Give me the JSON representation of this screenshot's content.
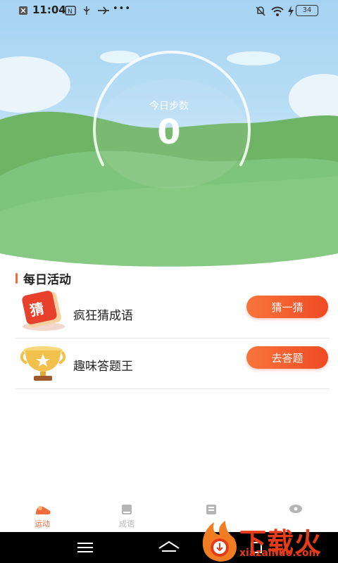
{
  "status_bar": {
    "time": "11:04",
    "notification_icons": [
      "close-box-icon",
      "mute-icon",
      "usb-icon",
      "airplane-icon"
    ],
    "more": "•••",
    "battery": "34"
  },
  "hero": {
    "label": "今日步数",
    "steps": "0"
  },
  "daily": {
    "title": "每日活动",
    "items": [
      {
        "icon_char": "猜",
        "label": "疯狂猜成语",
        "button": "猜一猜"
      },
      {
        "label": "趣味答题王",
        "button": "去答题"
      }
    ]
  },
  "tabs": [
    {
      "label": "运动",
      "active": true
    },
    {
      "label": "成语",
      "active": false
    },
    {
      "label": "",
      "active": false
    },
    {
      "label": "",
      "active": false
    }
  ],
  "watermark": {
    "text": "下载火",
    "url": "xiazaihuo.com"
  }
}
